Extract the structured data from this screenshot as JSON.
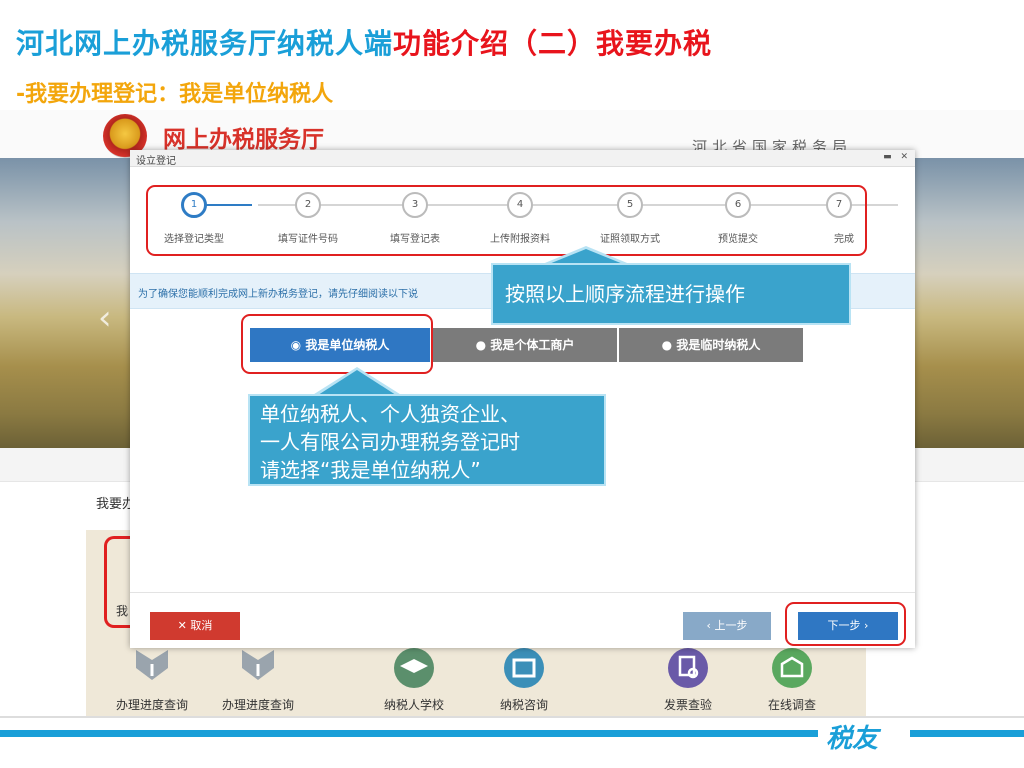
{
  "slide": {
    "title_part1": "河北网上办税服务厅纳税人端",
    "title_highlight": "功能介绍（二）我要办税",
    "subtitle": "-我要办理登记：我是单位纳税人",
    "footer_brand": "税友"
  },
  "site": {
    "name": "网上办税服务厅",
    "bureau": "河北省国家税务局"
  },
  "background_page": {
    "label": "我要办",
    "card_text": "我",
    "services": [
      {
        "label": "办理进度查询",
        "icon": "shield-download-icon"
      },
      {
        "label": "办理进度查询",
        "icon": "shield-download-icon"
      },
      {
        "label": "纳税人学校",
        "icon": "graduation-cap-icon"
      },
      {
        "label": "纳税咨询",
        "icon": "building-icon"
      },
      {
        "label": "发票查验",
        "icon": "document-search-icon"
      },
      {
        "label": "在线调查",
        "icon": "survey-icon"
      }
    ]
  },
  "dialog": {
    "title": "设立登记",
    "steps": [
      {
        "num": "1",
        "label": "选择登记类型"
      },
      {
        "num": "2",
        "label": "填写证件号码"
      },
      {
        "num": "3",
        "label": "填写登记表"
      },
      {
        "num": "4",
        "label": "上传附报资料"
      },
      {
        "num": "5",
        "label": "证照领取方式"
      },
      {
        "num": "6",
        "label": "预览提交"
      },
      {
        "num": "7",
        "label": "完成"
      }
    ],
    "current_step": 1,
    "notice": "为了确保您能顺利完成网上新办税务登记，请先仔细阅读以下说",
    "options": [
      "◉ 我是单位纳税人",
      "● 我是个体工商户",
      "● 我是临时纳税人"
    ],
    "cancel_label": "✕ 取消",
    "prev_label": "‹ 上一步",
    "next_label": "下一步 ›"
  },
  "callouts": {
    "steps_hint": "按照以上顺序流程进行操作",
    "unit_hint_line1": "单位纳税人、个人独资企业、",
    "unit_hint_line2": "一人有限公司办理税务登记时",
    "unit_hint_line3": "请选择“我是单位纳税人”"
  },
  "colors": {
    "title_blue": "#1a9fd8",
    "title_red": "#e8141c",
    "subtitle_orange": "#f3a60c",
    "primary_blue": "#2f77c3",
    "highlight_red": "#e02020",
    "callout_blue": "#3aa3cc"
  }
}
